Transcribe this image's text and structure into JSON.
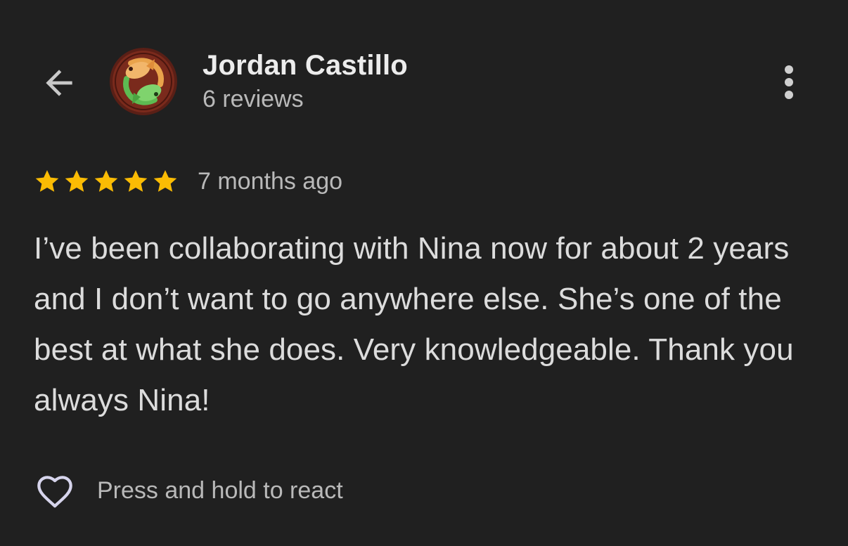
{
  "header": {
    "back_icon": "arrow-left-icon",
    "author_name": "Jordan Castillo",
    "review_count": "6 reviews",
    "avatar": "koi-fish-avatar",
    "more_icon": "more-vertical-icon"
  },
  "review": {
    "rating": 5,
    "max_rating": 5,
    "date": "7 months ago",
    "text": "I’ve been collaborating with Nina now for about 2 years and I don’t want to go anywhere else. She’s one of the best at what she does. Very knowledgeable. Thank you always Nina!"
  },
  "reaction": {
    "heart_icon": "heart-outline-icon",
    "hint": "Press and hold to react"
  },
  "colors": {
    "background": "#202020",
    "star": "#fbbc04",
    "primary_text": "#ececec",
    "secondary_text": "#b9b9b9"
  }
}
